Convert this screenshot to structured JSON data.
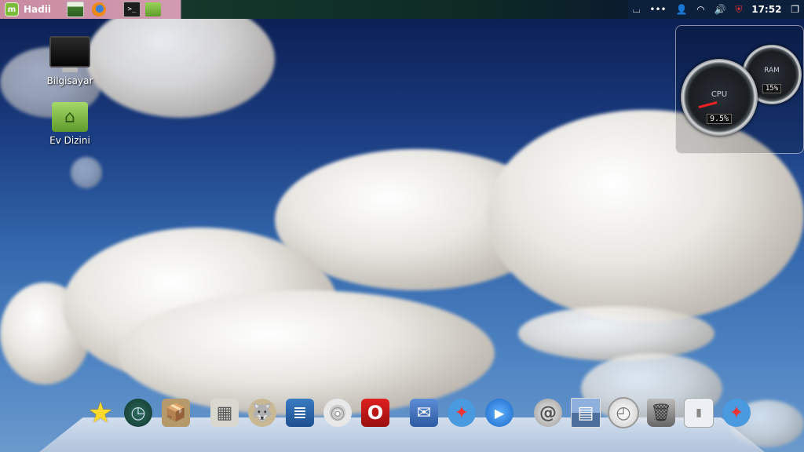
{
  "panel": {
    "menu_label": "Hadii",
    "clock": "17:52"
  },
  "desktop": {
    "icons": [
      {
        "label": "Bilgisayar",
        "icon": "computer-icon"
      },
      {
        "label": "Ev Dizini",
        "icon": "home-folder-icon"
      }
    ]
  },
  "gauges": {
    "cpu": {
      "label": "CPU",
      "value": "9.5%"
    },
    "ram": {
      "label": "RAM",
      "value": "15%"
    }
  },
  "dock": {
    "items": [
      {
        "name": "favorites-star-icon",
        "glyph": "★"
      },
      {
        "name": "time-machine-icon",
        "glyph": "◷"
      },
      {
        "name": "installer-box-icon",
        "glyph": "📦"
      },
      {
        "name": "calculator-icon",
        "glyph": "▦"
      },
      {
        "name": "gimp-icon",
        "glyph": "🐺"
      },
      {
        "name": "text-editor-icon",
        "glyph": "≣"
      },
      {
        "name": "cd-dvd-icon",
        "glyph": "◎"
      },
      {
        "name": "opera-browser-icon",
        "glyph": "O"
      },
      {
        "name": "mail-stamp-icon",
        "glyph": "✉"
      },
      {
        "name": "safari-compass-icon",
        "glyph": "✦"
      },
      {
        "name": "video-chat-icon",
        "glyph": "▶"
      },
      {
        "name": "address-book-icon",
        "glyph": "@"
      },
      {
        "name": "desktop-switcher-icon",
        "glyph": "▤"
      },
      {
        "name": "clock-widget-icon",
        "glyph": "◴"
      },
      {
        "name": "trash-icon",
        "glyph": "🗑"
      },
      {
        "name": "switch-toggle-icon",
        "glyph": "▮"
      },
      {
        "name": "safari-compass-icon-2",
        "glyph": "✦"
      }
    ]
  }
}
